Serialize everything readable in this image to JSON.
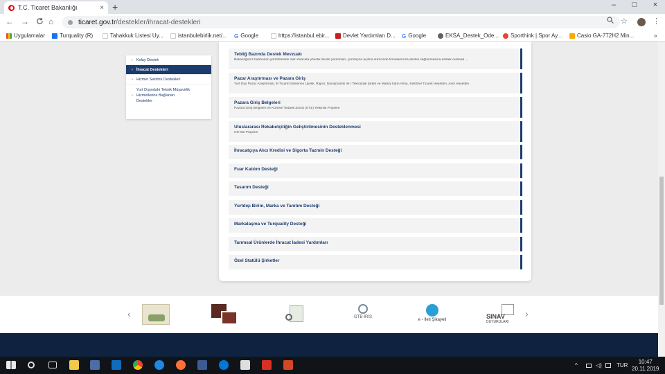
{
  "browser": {
    "tab_title": "T.C. Ticaret Bakanlığı",
    "tab_close": "×",
    "new_tab": "+",
    "window_controls": [
      "–",
      "□",
      "×"
    ],
    "nav": {
      "back": "←",
      "forward": "→",
      "reload": "C",
      "home": "⌂"
    },
    "url_host": "ticaret.gov.tr",
    "url_path": "/destekler/ihracat-destekleri",
    "omnibox_icons": [
      "zoom-icon",
      "star-icon"
    ],
    "menu": "⋮"
  },
  "bookmarks": [
    {
      "label": "Uygulamalar",
      "color": "#ea4335"
    },
    {
      "label": "Turquality (R)",
      "color": "#1a73e8"
    },
    {
      "label": "Tahakkuk Listesi Uy...",
      "color": "#ffffff"
    },
    {
      "label": "istanbulebirlik.net/...",
      "color": "#ffffff"
    },
    {
      "label": "Google",
      "color": "#4285f4"
    },
    {
      "label": "https://istanbul.ebir...",
      "color": "#ffffff"
    },
    {
      "label": "Devlet Yardımları D...",
      "color": "#c5221f"
    },
    {
      "label": "Google",
      "color": "#4285f4"
    },
    {
      "label": "EKSA_Destek_Ode...",
      "color": "#5f6368"
    },
    {
      "label": "Sporthink | Spor Ay...",
      "color": "#ea4335"
    },
    {
      "label": "Casio GA-772H2 Min...",
      "color": "#f9ab00"
    }
  ],
  "bookmarks_more": "»",
  "sidemenu": {
    "items": [
      {
        "label": "Kolay Destek",
        "active": false
      },
      {
        "label": "İhracat Destekleri",
        "active": true
      },
      {
        "label": "Hizmet Sektörü Destekleri",
        "active": false
      }
    ],
    "multi_line": [
      "Yurt Dışındaki Teknik Müşavirlik",
      "Hizmetlerine Bağlanan",
      "Destekler"
    ]
  },
  "entries": [
    {
      "title": "Tebliğ Bazında Destek Mevzuatı",
      "subtitle": "Bakanlığımız tarafından yürütülmekte olan ihracata yönelik devlet yardımları, yurtdışına açılma sürecinde firmalarımıza destek sağlanmasına destek outsead ..."
    },
    {
      "title": "Pazar Araştırması ve Pazara Giriş",
      "subtitle": "Yurt Dışı Pazar Araştırması, E-Ticaret Sitelerine Üyelik, Rapor, Danışmanlık ile İ Teknolojik Şirket ve Marka Satın Alma, Sektörel Ticaret Heyetleri, Alım Heyetleri"
    },
    {
      "title": "Pazara Giriş Belgeleri",
      "subtitle": "Pazara Giriş Belgeleri ve Küresel Tedarik Zinciri (KTZ) Yetkinlik Projeleri"
    },
    {
      "title": "Uluslararası Rekabetçiliğin Geliştirilmesinin Desteklenmesi",
      "subtitle": "UR-GE Projeleri"
    },
    {
      "title": "İhracatçıya Alıcı Kredisi ve Sigorta Tazmin Desteği",
      "subtitle": ""
    },
    {
      "title": "Fuar Katılım Desteği",
      "subtitle": ""
    },
    {
      "title": "Tasarım Desteği",
      "subtitle": ""
    },
    {
      "title": "Yurtdışı Birim, Marka ve Tanıtım Desteği",
      "subtitle": ""
    },
    {
      "title": "Markalaşma ve Turquality Desteği",
      "subtitle": ""
    },
    {
      "title": "Tarımsal Ürünlerde İhracat İadesi Yardımları",
      "subtitle": ""
    },
    {
      "title": "Özel Statülü Şirketler",
      "subtitle": ""
    }
  ],
  "logos": {
    "prev": "‹",
    "next": "›",
    "gtb_iris": "GTB-İRİS",
    "e_sikayet": "e - İleti Şikayeti",
    "sinav": "SINAV",
    "sinav_sub": "DUYURULARI"
  },
  "taskbar": {
    "tray": "^",
    "lang": "TUR",
    "time": "10:47",
    "date": "20.11.2019"
  }
}
